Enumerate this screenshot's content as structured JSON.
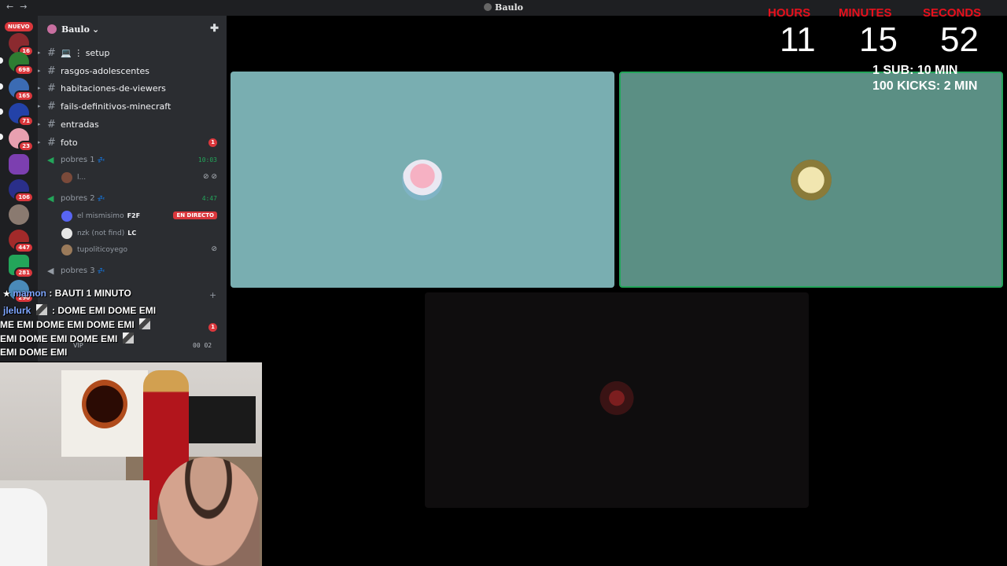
{
  "window": {
    "title": "Baulo",
    "nav_back": "←",
    "nav_forward": "→"
  },
  "server_rail": {
    "new_badge": "NUEVO",
    "badges": [
      "16",
      "698",
      "165",
      "71",
      "23",
      "106",
      "447",
      "281",
      "290"
    ]
  },
  "server": {
    "name": "Baulo",
    "chevron": "⌄"
  },
  "text_channels": [
    {
      "name": "💻 ⋮ setup",
      "badge": ""
    },
    {
      "name": "rasgos-adolescentes",
      "badge": ""
    },
    {
      "name": "habitaciones-de-viewers",
      "badge": ""
    },
    {
      "name": "fails-definitivos-minecraft",
      "badge": ""
    },
    {
      "name": "entradas",
      "badge": ""
    },
    {
      "name": "foto",
      "badge": "1"
    }
  ],
  "voice_channels": [
    {
      "name": "pobres 1",
      "time": "10:03",
      "users": [
        {
          "name": "l...",
          "tag": "",
          "live": ""
        }
      ]
    },
    {
      "name": "pobres 2",
      "time": "4:47",
      "users": [
        {
          "name": "el mismisimo",
          "tag": "F2F",
          "live": "EN DIRECTO"
        },
        {
          "name": "nzk (not find)",
          "tag": "LC",
          "live": ""
        },
        {
          "name": "tupoliticoyego",
          "tag": "",
          "live": ""
        }
      ]
    },
    {
      "name": "pobres 3",
      "time": "",
      "users": []
    }
  ],
  "sleep_icon": "💤",
  "timer": {
    "hours_label": "HOURS",
    "minutes_label": "MINUTES",
    "seconds_label": "SECONDS",
    "hours": "11",
    "minutes": "15",
    "seconds": "52",
    "rule_1": "1 SUB: 10 MIN",
    "rule_2": "100 KICKS: 2 MIN"
  },
  "chat": [
    {
      "user": "mamon",
      "message": ": BAUTI 1 MINUTO"
    },
    {
      "user": "jlelurk",
      "message": ": DOME EMI DOME EMI"
    },
    {
      "user": "",
      "message": "ME EMI DOME EMI DOME EMI"
    },
    {
      "user": "",
      "message": "EMI DOME EMI DOME EMI"
    },
    {
      "user": "",
      "message": "EMI DOME EMI"
    }
  ],
  "peeking": {
    "badge": "1",
    "time": "00 02",
    "vip": "VIP"
  },
  "colors": {
    "accent_red": "#e8101c",
    "speaking_green": "#23a55a",
    "tile_1": "#79aeb1",
    "tile_2": "#5b8f84"
  }
}
